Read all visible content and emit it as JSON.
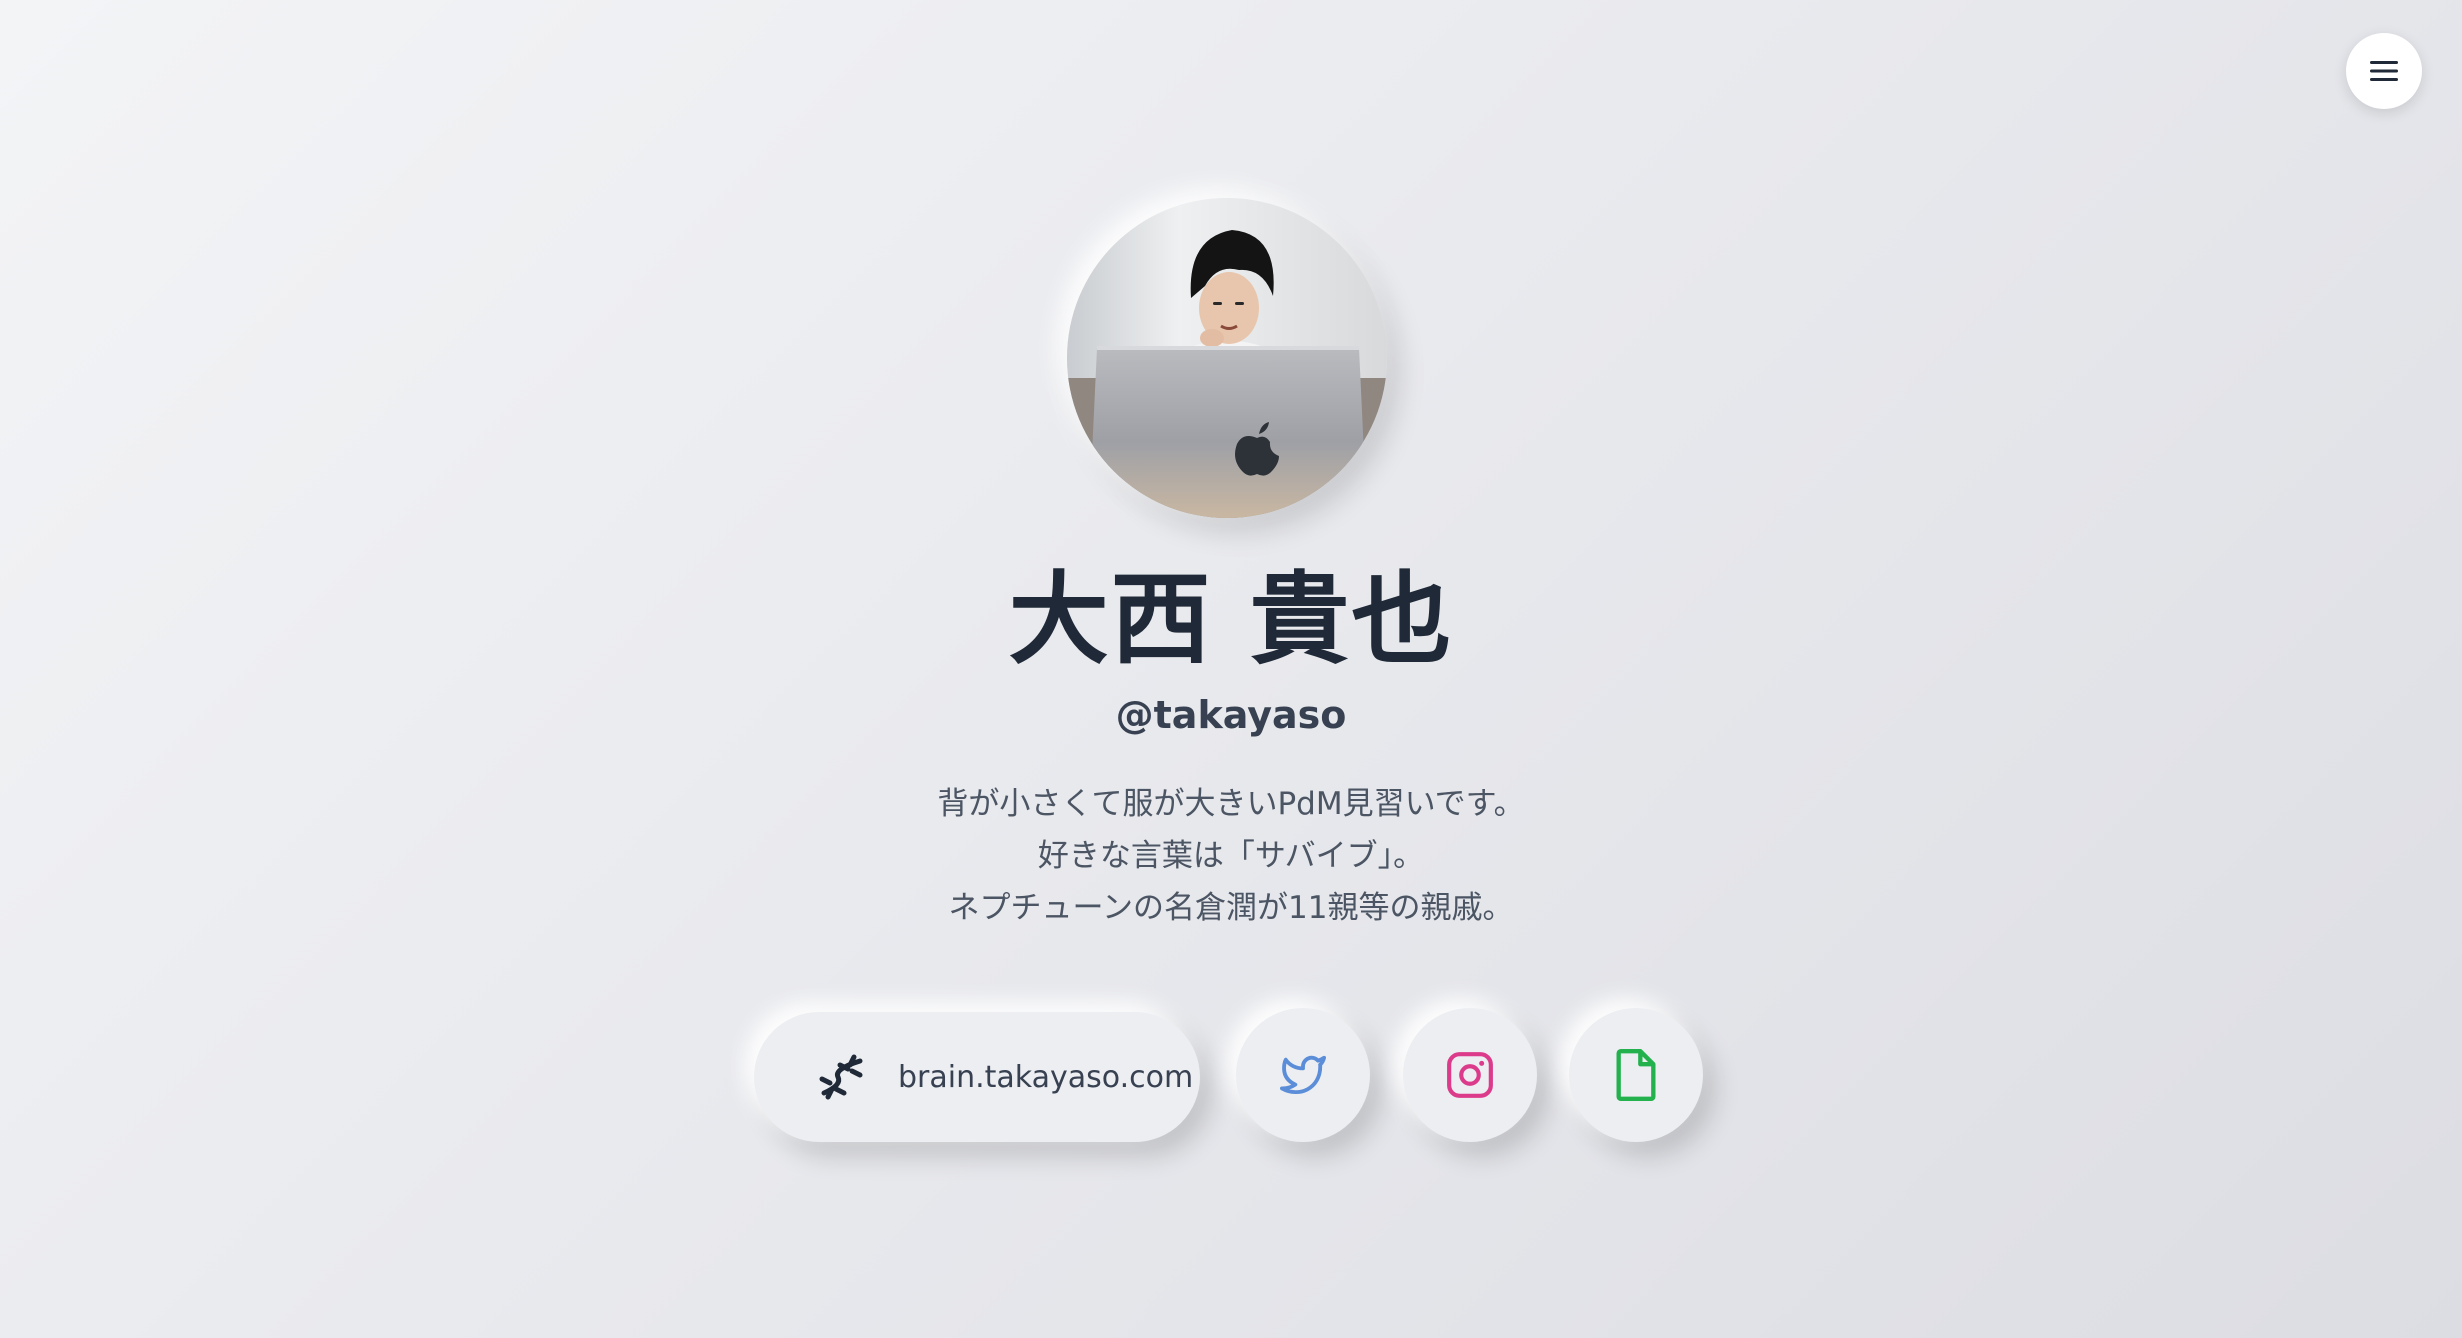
{
  "profile": {
    "name": "大西 貴也",
    "handle": "@takayaso",
    "bio": [
      "背が小さくて服が大きいPdM見習いです。",
      "好きな言葉は「サバイブ」。",
      "ネプチューンの名倉潤が11親等の親戚。"
    ]
  },
  "links": {
    "website": {
      "label": "brain.takayaso.com",
      "icon": "dna-icon"
    },
    "twitter": {
      "icon": "twitter-icon",
      "color": "#5b8dd8"
    },
    "instagram": {
      "icon": "instagram-icon",
      "color": "#db3b8a"
    },
    "document": {
      "icon": "document-icon",
      "color": "#22b14c"
    }
  },
  "menu": {
    "icon": "hamburger-menu-icon"
  },
  "colors": {
    "text_primary": "#1f2937",
    "text_secondary": "#4b5563",
    "background": "#e9eaee"
  }
}
